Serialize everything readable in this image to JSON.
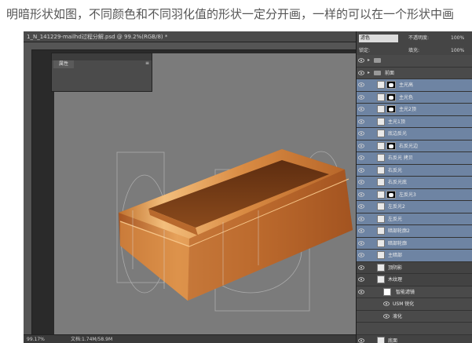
{
  "caption": "明暗形状如图，不同颜色和不同羽化值的形状一定分开画，一样的可以在一个形状中画",
  "document": {
    "title": "1_N_141229-mailhd过程分解.psd @ 99.2%(RGB/8) *",
    "zoom": "99.17%",
    "doc_size": "文档:1.74M/58.9M"
  },
  "properties_panel": {
    "tab": "属性",
    "menu_icon": "≡"
  },
  "layers_panel": {
    "blend_mode": "滤色",
    "opacity_label": "不透明度:",
    "opacity_value": "100%",
    "lock_label": "锁定:",
    "fill_label": "填充:",
    "fill_value": "100%",
    "layers": [
      {
        "name": "",
        "type": "group",
        "selected": false,
        "mask": false
      },
      {
        "name": "前面",
        "type": "group",
        "selected": false,
        "mask": false
      },
      {
        "name": "主光高",
        "type": "layer",
        "selected": true,
        "mask": true
      },
      {
        "name": "主光色",
        "type": "layer",
        "selected": true,
        "mask": true
      },
      {
        "name": "主光2顶",
        "type": "layer",
        "selected": true,
        "mask": true
      },
      {
        "name": "主光1顶",
        "type": "layer",
        "selected": true,
        "mask": false
      },
      {
        "name": "底边反光",
        "type": "layer",
        "selected": true,
        "mask": false
      },
      {
        "name": "右反光边",
        "type": "layer",
        "selected": true,
        "mask": true
      },
      {
        "name": "右反光 拷贝",
        "type": "layer",
        "selected": true,
        "mask": false
      },
      {
        "name": "右反光",
        "type": "layer",
        "selected": true,
        "mask": false
      },
      {
        "name": "右反光底",
        "type": "layer",
        "selected": true,
        "mask": false
      },
      {
        "name": "左反光3",
        "type": "layer",
        "selected": true,
        "mask": true
      },
      {
        "name": "左反光2",
        "type": "layer",
        "selected": true,
        "mask": false
      },
      {
        "name": "左反光",
        "type": "layer",
        "selected": true,
        "mask": false
      },
      {
        "name": "暗部轮廓2",
        "type": "layer",
        "selected": true,
        "mask": false
      },
      {
        "name": "暗部轮廓",
        "type": "layer",
        "selected": true,
        "mask": false
      },
      {
        "name": "主暗部",
        "type": "layer",
        "selected": true,
        "mask": false
      },
      {
        "name": "顶阴影",
        "type": "layer",
        "selected": false,
        "mask": false
      },
      {
        "name": "木纹理",
        "type": "layer",
        "selected": false,
        "mask": false
      },
      {
        "name": "智能滤镜",
        "type": "fx",
        "selected": false,
        "mask": true
      },
      {
        "name": "USM 锐化",
        "type": "fx",
        "selected": false,
        "mask": false
      },
      {
        "name": "液化",
        "type": "fx",
        "selected": false,
        "mask": false
      },
      {
        "name": "",
        "type": "spacer",
        "selected": false,
        "mask": false
      },
      {
        "name": "底面",
        "type": "layer",
        "selected": false,
        "mask": false
      }
    ]
  },
  "colors": {
    "selected_row": "#6e84a3",
    "canvas_bg": "#7b7b7b",
    "wood_light": "#f0b772",
    "wood_dark": "#7a3a14"
  }
}
